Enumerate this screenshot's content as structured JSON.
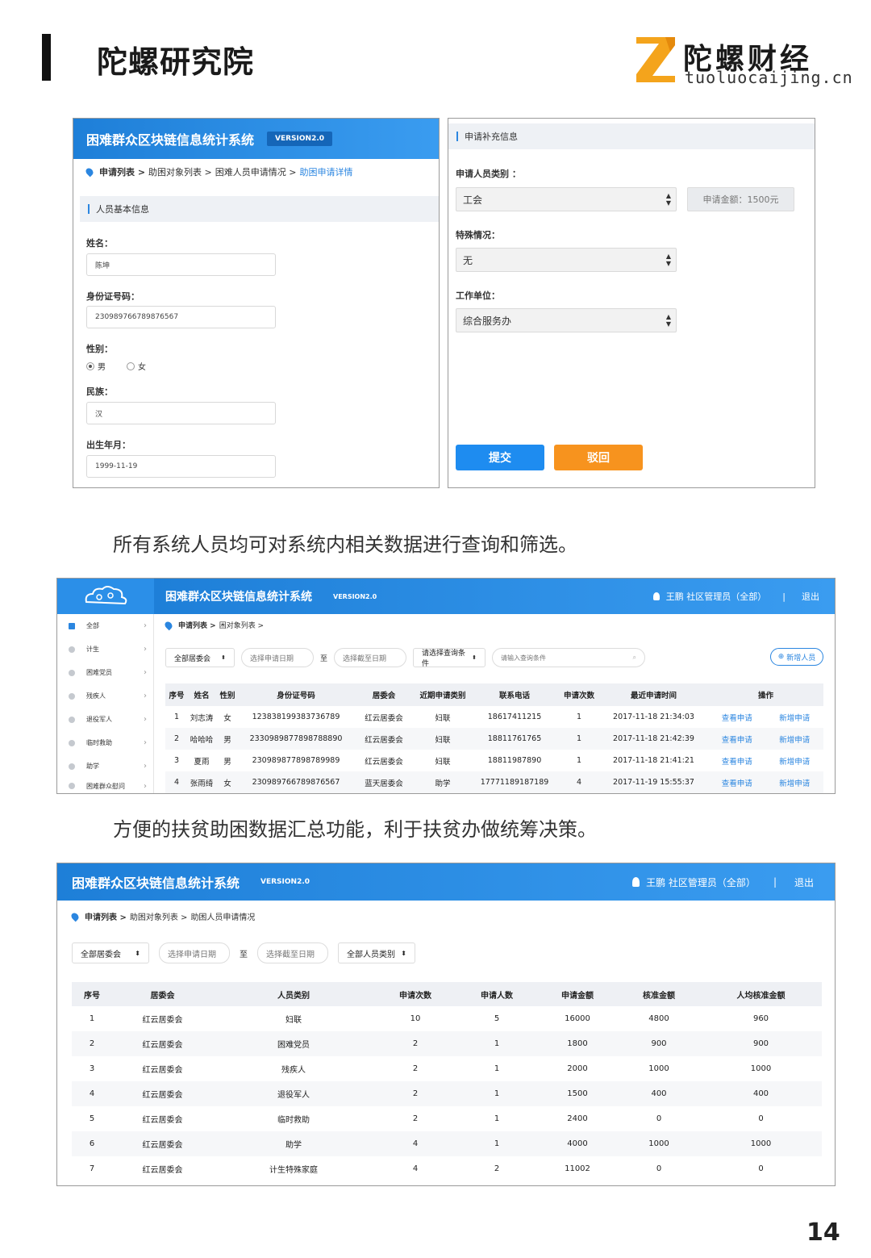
{
  "header": {
    "title": "陀螺研究院",
    "logo_cn": "陀螺财经",
    "logo_en": "tuoluocaijing.cn"
  },
  "panel1": {
    "sys_title": "困难群众区块链信息统计系统",
    "version": "VERSION2.0",
    "crumb": [
      "申请列表 >",
      "助困对象列表 >",
      "困难人员申请情况 >",
      "助困申请详情"
    ],
    "section": "人员基本信息",
    "name_label": "姓名：",
    "name_value": "陈坤",
    "id_label": "身份证号码：",
    "id_value": "230989766789876567",
    "gender_label": "性别：",
    "gender_male": "男",
    "gender_female": "女",
    "ethnic_label": "民族：",
    "ethnic_value": "汉",
    "birth_label": "出生年月：",
    "birth_value": "1999-11-19"
  },
  "panel2": {
    "section": "申请补充信息",
    "category_label": "申请人员类别 ：",
    "category_value": "工会",
    "amount": "申请金额：1500元",
    "special_label": "特殊情况：",
    "special_value": "无",
    "work_label": "工作单位：",
    "work_value": "综合服务办",
    "submit": "提交",
    "reject": "驳回"
  },
  "caption1": "所有系统人员均可对系统内相关数据进行查询和筛选。",
  "panel3": {
    "sys_title": "困难群众区块链信息统计系统",
    "version": "VERSION2.0",
    "user": "王鹏 社区管理员（全部）",
    "sep": "|",
    "logout": "退出",
    "sidebar": [
      "全部",
      "计生",
      "困难党员",
      "残疾人",
      "退役军人",
      "临时救助",
      "助学",
      "困难群众慰问"
    ],
    "crumb": [
      "申请列表 >",
      "困对象列表 >"
    ],
    "filter_committee": "全部居委会",
    "filter_start": "选择申请日期",
    "filter_to": "至",
    "filter_end": "选择截至日期",
    "filter_cond": "请选择查询条件",
    "filter_search": "请输入查询条件",
    "add_button": "新增人员",
    "headers": [
      "序号",
      "姓名",
      "性别",
      "身份证号码",
      "居委会",
      "近期申请类别",
      "联系电话",
      "申请次数",
      "最近申请时间",
      "操作"
    ],
    "rows": [
      [
        "1",
        "刘志涛",
        "女",
        "123838199383736789",
        "红云居委会",
        "妇联",
        "18617411215",
        "1",
        "2017-11-18 21:34:03",
        "查看申请",
        "新增申请"
      ],
      [
        "2",
        "哈哈哈",
        "男",
        "2330989877898788890",
        "红云居委会",
        "妇联",
        "18811761765",
        "1",
        "2017-11-18 21:42:39",
        "查看申请",
        "新增申请"
      ],
      [
        "3",
        "夏雨",
        "男",
        "230989877898789989",
        "红云居委会",
        "妇联",
        "18811987890",
        "1",
        "2017-11-18 21:41:21",
        "查看申请",
        "新增申请"
      ],
      [
        "4",
        "张雨绮",
        "女",
        "230989766789876567",
        "蓝天居委会",
        "助学",
        "17771189187189",
        "4",
        "2017-11-19 15:55:37",
        "查看申请",
        "新增申请"
      ]
    ]
  },
  "caption2": "方便的扶贫助困数据汇总功能，利于扶贫办做统筹决策。",
  "panel4": {
    "sys_title": "困难群众区块链信息统计系统",
    "version": "VERSION2.0",
    "user": "王鹏 社区管理员（全部）",
    "sep": "|",
    "logout": "退出",
    "crumb": [
      "申请列表 >",
      "助困对象列表 >",
      "助困人员申请情况"
    ],
    "filter_committee": "全部居委会",
    "filter_start": "选择申请日期",
    "filter_to": "至",
    "filter_end": "选择截至日期",
    "filter_type": "全部人员类别",
    "headers": [
      "序号",
      "居委会",
      "人员类别",
      "申请次数",
      "申请人数",
      "申请金额",
      "核准金额",
      "人均核准金额"
    ],
    "rows": [
      [
        "1",
        "红云居委会",
        "妇联",
        "10",
        "5",
        "16000",
        "4800",
        "960"
      ],
      [
        "2",
        "红云居委会",
        "困难党员",
        "2",
        "1",
        "1800",
        "900",
        "900"
      ],
      [
        "3",
        "红云居委会",
        "残疾人",
        "2",
        "1",
        "2000",
        "1000",
        "1000"
      ],
      [
        "4",
        "红云居委会",
        "退役军人",
        "2",
        "1",
        "1500",
        "400",
        "400"
      ],
      [
        "5",
        "红云居委会",
        "临时救助",
        "2",
        "1",
        "2400",
        "0",
        "0"
      ],
      [
        "6",
        "红云居委会",
        "助学",
        "4",
        "1",
        "4000",
        "1000",
        "1000"
      ],
      [
        "7",
        "红云居委会",
        "计生特殊家庭",
        "4",
        "2",
        "11002",
        "0",
        "0"
      ]
    ]
  },
  "page_number": "14"
}
